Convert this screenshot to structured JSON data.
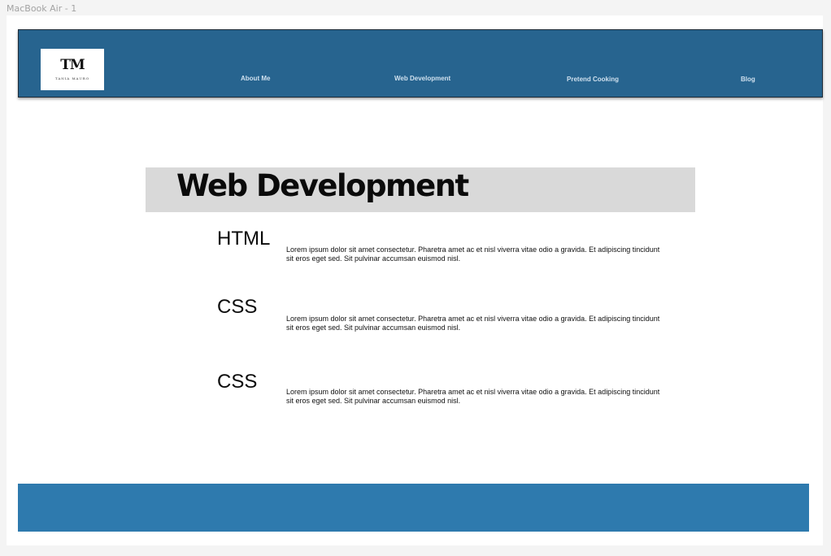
{
  "frame": {
    "label": "MacBook Air - 1"
  },
  "header": {
    "logo": {
      "monogram": "TM",
      "name": "TANIA MAURO"
    },
    "nav": [
      {
        "label": "About Me"
      },
      {
        "label": "Web Development"
      },
      {
        "label": "Pretend Cooking"
      },
      {
        "label": "Blog"
      }
    ]
  },
  "main": {
    "title": "Web Development",
    "sections": [
      {
        "heading": "HTML",
        "text": "Lorem ipsum dolor sit amet consectetur. Pharetra amet ac et nisl viverra vitae odio a gravida. Et adipiscing tincidunt sit eros eget sed. Sit pulvinar accumsan euismod nisl."
      },
      {
        "heading": "CSS",
        "text": "Lorem ipsum dolor sit amet consectetur. Pharetra amet ac et nisl viverra vitae odio a gravida. Et adipiscing tincidunt sit eros eget sed. Sit pulvinar accumsan euismod nisl."
      },
      {
        "heading": "CSS",
        "text": "Lorem ipsum dolor sit amet consectetur. Pharetra amet ac et nisl viverra vitae odio a gravida. Et adipiscing tincidunt sit eros eget sed. Sit pulvinar accumsan euismod nisl."
      }
    ]
  },
  "colors": {
    "navbar": "#27648f",
    "footer": "#2e7aae",
    "title_bar": "#d9d9d9",
    "canvas": "#f4f4f4",
    "artboard": "#ffffff"
  }
}
